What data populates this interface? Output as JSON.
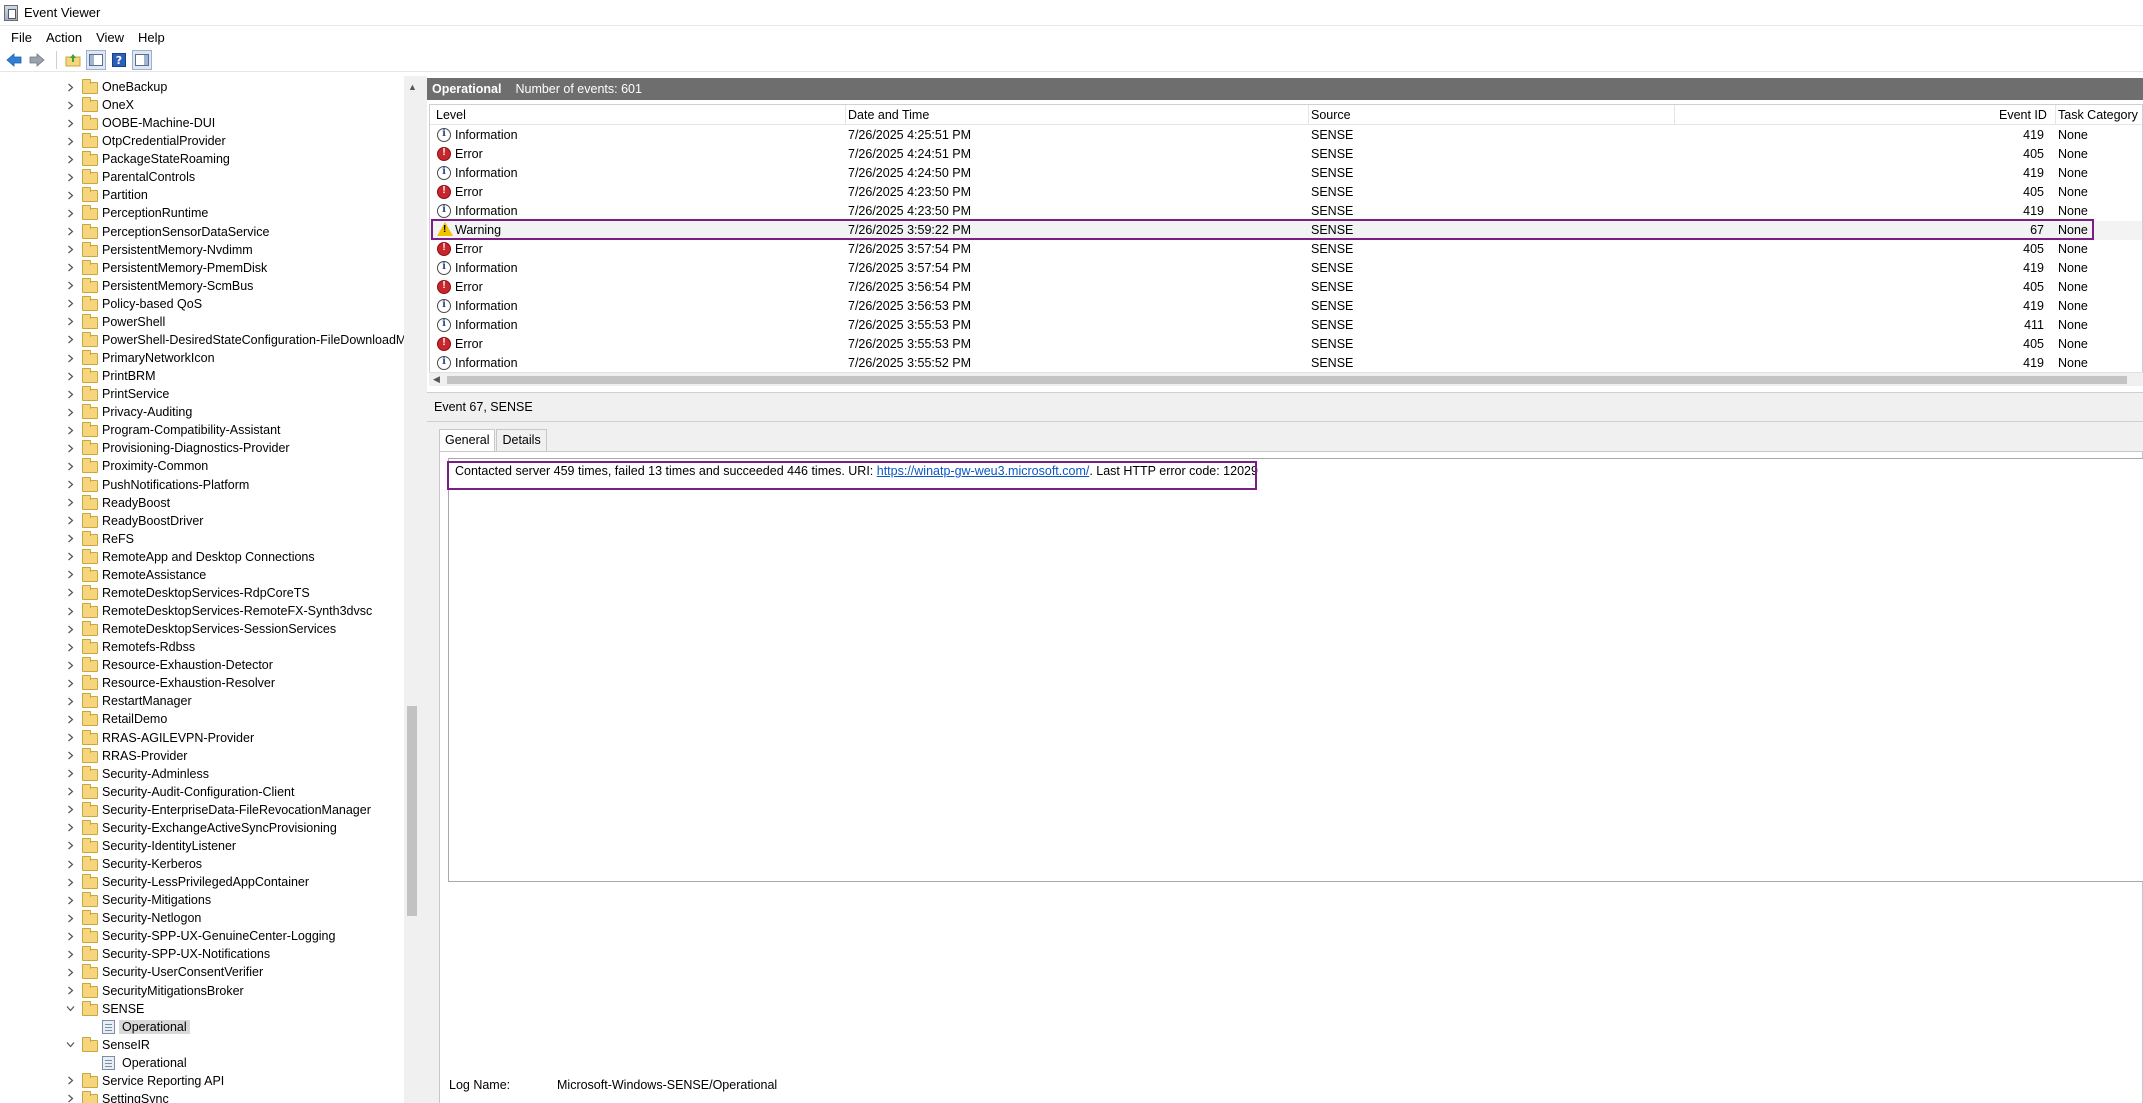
{
  "window": {
    "title": "Event Viewer"
  },
  "menu": [
    "File",
    "Action",
    "View",
    "Help"
  ],
  "toolbar": {
    "icons": [
      "back-arrow-icon",
      "forward-arrow-icon",
      "folder-up-icon",
      "show-hide-tree-icon",
      "help-icon",
      "show-action-pane-icon"
    ]
  },
  "tree": {
    "items": [
      {
        "label": "OneBackup",
        "type": "folder",
        "expanded": false
      },
      {
        "label": "OneX",
        "type": "folder",
        "expanded": false
      },
      {
        "label": "OOBE-Machine-DUI",
        "type": "folder",
        "expanded": false
      },
      {
        "label": "OtpCredentialProvider",
        "type": "folder",
        "expanded": false
      },
      {
        "label": "PackageStateRoaming",
        "type": "folder",
        "expanded": false
      },
      {
        "label": "ParentalControls",
        "type": "folder",
        "expanded": false
      },
      {
        "label": "Partition",
        "type": "folder",
        "expanded": false
      },
      {
        "label": "PerceptionRuntime",
        "type": "folder",
        "expanded": false
      },
      {
        "label": "PerceptionSensorDataService",
        "type": "folder",
        "expanded": false
      },
      {
        "label": "PersistentMemory-Nvdimm",
        "type": "folder",
        "expanded": false
      },
      {
        "label": "PersistentMemory-PmemDisk",
        "type": "folder",
        "expanded": false
      },
      {
        "label": "PersistentMemory-ScmBus",
        "type": "folder",
        "expanded": false
      },
      {
        "label": "Policy-based QoS",
        "type": "folder",
        "expanded": false
      },
      {
        "label": "PowerShell",
        "type": "folder",
        "expanded": false
      },
      {
        "label": "PowerShell-DesiredStateConfiguration-FileDownloadMar",
        "type": "folder",
        "expanded": false
      },
      {
        "label": "PrimaryNetworkIcon",
        "type": "folder",
        "expanded": false
      },
      {
        "label": "PrintBRM",
        "type": "folder",
        "expanded": false
      },
      {
        "label": "PrintService",
        "type": "folder",
        "expanded": false
      },
      {
        "label": "Privacy-Auditing",
        "type": "folder",
        "expanded": false
      },
      {
        "label": "Program-Compatibility-Assistant",
        "type": "folder",
        "expanded": false
      },
      {
        "label": "Provisioning-Diagnostics-Provider",
        "type": "folder",
        "expanded": false
      },
      {
        "label": "Proximity-Common",
        "type": "folder",
        "expanded": false
      },
      {
        "label": "PushNotifications-Platform",
        "type": "folder",
        "expanded": false
      },
      {
        "label": "ReadyBoost",
        "type": "folder",
        "expanded": false
      },
      {
        "label": "ReadyBoostDriver",
        "type": "folder",
        "expanded": false
      },
      {
        "label": "ReFS",
        "type": "folder",
        "expanded": false
      },
      {
        "label": "RemoteApp and Desktop Connections",
        "type": "folder",
        "expanded": false
      },
      {
        "label": "RemoteAssistance",
        "type": "folder",
        "expanded": false
      },
      {
        "label": "RemoteDesktopServices-RdpCoreTS",
        "type": "folder",
        "expanded": false
      },
      {
        "label": "RemoteDesktopServices-RemoteFX-Synth3dvsc",
        "type": "folder",
        "expanded": false
      },
      {
        "label": "RemoteDesktopServices-SessionServices",
        "type": "folder",
        "expanded": false
      },
      {
        "label": "Remotefs-Rdbss",
        "type": "folder",
        "expanded": false
      },
      {
        "label": "Resource-Exhaustion-Detector",
        "type": "folder",
        "expanded": false
      },
      {
        "label": "Resource-Exhaustion-Resolver",
        "type": "folder",
        "expanded": false
      },
      {
        "label": "RestartManager",
        "type": "folder",
        "expanded": false
      },
      {
        "label": "RetailDemo",
        "type": "folder",
        "expanded": false
      },
      {
        "label": "RRAS-AGILEVPN-Provider",
        "type": "folder",
        "expanded": false
      },
      {
        "label": "RRAS-Provider",
        "type": "folder",
        "expanded": false
      },
      {
        "label": "Security-Adminless",
        "type": "folder",
        "expanded": false
      },
      {
        "label": "Security-Audit-Configuration-Client",
        "type": "folder",
        "expanded": false
      },
      {
        "label": "Security-EnterpriseData-FileRevocationManager",
        "type": "folder",
        "expanded": false
      },
      {
        "label": "Security-ExchangeActiveSyncProvisioning",
        "type": "folder",
        "expanded": false
      },
      {
        "label": "Security-IdentityListener",
        "type": "folder",
        "expanded": false
      },
      {
        "label": "Security-Kerberos",
        "type": "folder",
        "expanded": false
      },
      {
        "label": "Security-LessPrivilegedAppContainer",
        "type": "folder",
        "expanded": false
      },
      {
        "label": "Security-Mitigations",
        "type": "folder",
        "expanded": false
      },
      {
        "label": "Security-Netlogon",
        "type": "folder",
        "expanded": false
      },
      {
        "label": "Security-SPP-UX-GenuineCenter-Logging",
        "type": "folder",
        "expanded": false
      },
      {
        "label": "Security-SPP-UX-Notifications",
        "type": "folder",
        "expanded": false
      },
      {
        "label": "Security-UserConsentVerifier",
        "type": "folder",
        "expanded": false
      },
      {
        "label": "SecurityMitigationsBroker",
        "type": "folder",
        "expanded": false
      },
      {
        "label": "SENSE",
        "type": "folder",
        "expanded": true
      },
      {
        "label": "Operational",
        "type": "log",
        "selected": true
      },
      {
        "label": "SenseIR",
        "type": "folder",
        "expanded": true
      },
      {
        "label": "Operational",
        "type": "log",
        "selected": false
      },
      {
        "label": "Service Reporting API",
        "type": "folder",
        "expanded": false
      },
      {
        "label": "SettingSync",
        "type": "folder",
        "expanded": false
      }
    ]
  },
  "events_header": {
    "title": "Operational",
    "count_text": "Number of events: 601"
  },
  "columns": [
    "Level",
    "Date and Time",
    "Source",
    "Event ID",
    "Task Category"
  ],
  "events": [
    {
      "level": "Information",
      "icon": "info-icon",
      "datetime": "7/26/2025 4:25:51 PM",
      "source": "SENSE",
      "event_id": "419",
      "task": "None"
    },
    {
      "level": "Error",
      "icon": "error-icon",
      "datetime": "7/26/2025 4:24:51 PM",
      "source": "SENSE",
      "event_id": "405",
      "task": "None"
    },
    {
      "level": "Information",
      "icon": "info-icon",
      "datetime": "7/26/2025 4:24:50 PM",
      "source": "SENSE",
      "event_id": "419",
      "task": "None"
    },
    {
      "level": "Error",
      "icon": "error-icon",
      "datetime": "7/26/2025 4:23:50 PM",
      "source": "SENSE",
      "event_id": "405",
      "task": "None"
    },
    {
      "level": "Information",
      "icon": "info-icon",
      "datetime": "7/26/2025 4:23:50 PM",
      "source": "SENSE",
      "event_id": "419",
      "task": "None"
    },
    {
      "level": "Warning",
      "icon": "warning-icon",
      "datetime": "7/26/2025 3:59:22 PM",
      "source": "SENSE",
      "event_id": "67",
      "task": "None",
      "selected": true
    },
    {
      "level": "Error",
      "icon": "error-icon",
      "datetime": "7/26/2025 3:57:54 PM",
      "source": "SENSE",
      "event_id": "405",
      "task": "None"
    },
    {
      "level": "Information",
      "icon": "info-icon",
      "datetime": "7/26/2025 3:57:54 PM",
      "source": "SENSE",
      "event_id": "419",
      "task": "None"
    },
    {
      "level": "Error",
      "icon": "error-icon",
      "datetime": "7/26/2025 3:56:54 PM",
      "source": "SENSE",
      "event_id": "405",
      "task": "None"
    },
    {
      "level": "Information",
      "icon": "info-icon",
      "datetime": "7/26/2025 3:56:53 PM",
      "source": "SENSE",
      "event_id": "419",
      "task": "None"
    },
    {
      "level": "Information",
      "icon": "info-icon",
      "datetime": "7/26/2025 3:55:53 PM",
      "source": "SENSE",
      "event_id": "411",
      "task": "None"
    },
    {
      "level": "Error",
      "icon": "error-icon",
      "datetime": "7/26/2025 3:55:53 PM",
      "source": "SENSE",
      "event_id": "405",
      "task": "None"
    },
    {
      "level": "Information",
      "icon": "info-icon",
      "datetime": "7/26/2025 3:55:52 PM",
      "source": "SENSE",
      "event_id": "419",
      "task": "None"
    }
  ],
  "detail": {
    "title": "Event 67, SENSE",
    "tabs": [
      "General",
      "Details"
    ],
    "active_tab": "General",
    "description_prefix": "Contacted server 459 times, failed 13 times and succeeded 446 times. URI: ",
    "description_link": "https://winatp-gw-weu3.microsoft.com/",
    "description_suffix": ". Last HTTP error code: 12029",
    "log_name_label": "Log Name:",
    "log_name_value": "Microsoft-Windows-SENSE/Operational"
  },
  "colors": {
    "highlight_box": "#7b1d86",
    "header_bar": "#6e6e6e",
    "link": "#0b57c6",
    "error": "#c6262e",
    "warning": "#f2c200"
  }
}
